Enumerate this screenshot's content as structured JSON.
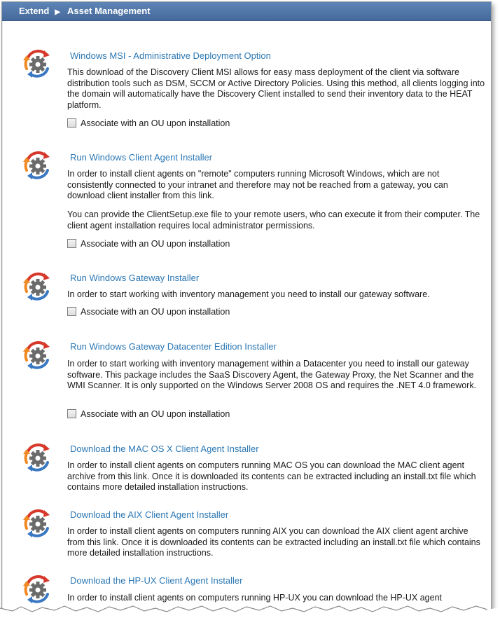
{
  "breadcrumb": {
    "items": [
      "Extend",
      "Asset Management"
    ],
    "separator": "▶"
  },
  "items": [
    {
      "icon": "gear-arrows-icon",
      "title": "Windows MSI - Administrative Deployment Option",
      "paragraphs": [
        "This download of the Discovery Client MSI allows for easy mass deployment of the client via software distribution tools such as DSM, SCCM or Active Directory Policies. Using this method, all clients logging into the domain will automatically have the Discovery Client installed to send their inventory data to the HEAT platform."
      ],
      "checkbox_label": "Associate with an OU upon installation",
      "checked": false
    },
    {
      "icon": "gear-arrows-icon",
      "title": "Run Windows Client Agent Installer",
      "paragraphs": [
        "In order to install client agents on \"remote\" computers running Microsoft Windows, which are not consistently connected to your intranet and therefore may not be reached from a gateway, you can download client installer from this link.",
        "You can provide the ClientSetup.exe file to your remote users, who can execute it from their computer. The client agent installation requires local administrator permissions."
      ],
      "checkbox_label": "Associate with an OU upon installation",
      "checked": false
    },
    {
      "icon": "gear-arrows-icon",
      "title": "Run Windows Gateway Installer",
      "paragraphs": [
        "In order to start working with inventory management you need to install our gateway software."
      ],
      "checkbox_label": "Associate with an OU upon installation",
      "checked": false
    },
    {
      "icon": "gear-arrows-icon",
      "title": "Run Windows Gateway Datacenter Edition Installer",
      "paragraphs": [
        "In order to start working with inventory management within a Datacenter you need to install our gateway software. This package includes the SaaS Discovery Agent, the Gateway Proxy, the Net Scanner and the WMI Scanner. It is only supported on the Windows Server 2008 OS and requires the .NET 4.0 framework."
      ],
      "checkbox_label": "Associate with an OU upon installation",
      "checked": false
    },
    {
      "icon": "gear-arrows-icon",
      "title": "Download the MAC OS X Client Agent Installer",
      "paragraphs": [
        "In order to install client agents on computers running MAC OS you can download the MAC client agent archive from this link. Once it is downloaded its contents can be extracted including an install.txt file which contains more detailed installation instructions."
      ]
    },
    {
      "icon": "gear-arrows-icon",
      "title": "Download the AIX Client Agent Installer",
      "paragraphs": [
        "In order to install client agents on computers running AIX you can download the AIX client agent archive from this link. Once it is downloaded its contents can be extracted including an install.txt file which contains more detailed installation instructions."
      ]
    },
    {
      "icon": "gear-arrows-icon",
      "title": "Download the HP-UX Client Agent Installer",
      "paragraphs": [
        "In order to install client agents on computers running HP-UX you can download the HP-UX agent"
      ]
    }
  ],
  "colors": {
    "header_bg": "#4f77a8",
    "link": "#2c78b4",
    "icon_red": "#d6392b",
    "icon_orange": "#f08a24",
    "icon_blue": "#3a78c2",
    "gear": "#6b6b6b"
  }
}
